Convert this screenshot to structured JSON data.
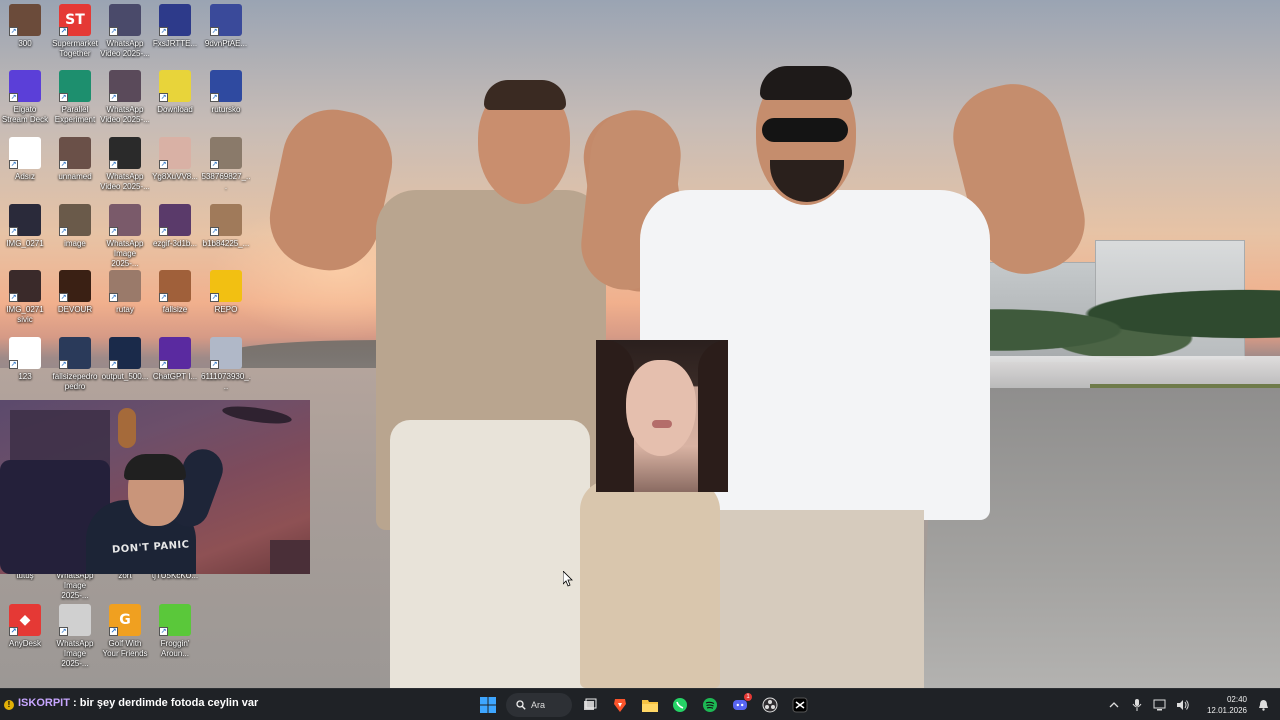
{
  "desktop": {
    "icons": [
      {
        "label": "300",
        "color": "#6b4b3a"
      },
      {
        "label": "Supermarket Together",
        "color": "#e53935",
        "glyph": "ST"
      },
      {
        "label": "WhatsApp Video 2025-...",
        "color": "#4a4a6a"
      },
      {
        "label": "FxsJRTTE...",
        "color": "#2d3a8a"
      },
      {
        "label": "9dvnPtAE...",
        "color": "#3a4a9a"
      },
      {
        "label": "Elgato Stream Deck",
        "color": "#5b3fd8"
      },
      {
        "label": "Parallel Experiment",
        "color": "#1d8f6e"
      },
      {
        "label": "WhatsApp Video 2025-...",
        "color": "#5a4a5a"
      },
      {
        "label": "Download",
        "color": "#e8d43a"
      },
      {
        "label": "rutursko",
        "color": "#2f4aa0"
      },
      {
        "label": "Adsız",
        "color": "#ffffff"
      },
      {
        "label": "unnamed",
        "color": "#6a5048"
      },
      {
        "label": "WhatsApp Video 2025-...",
        "color": "#2a2a2a"
      },
      {
        "label": "Yg8XuVV8...",
        "color": "#d9b1a5"
      },
      {
        "label": "538769827_...",
        "color": "#8a7a6a"
      },
      {
        "label": "IMG_0271",
        "color": "#2a2a3a"
      },
      {
        "label": "image",
        "color": "#6a5a4a"
      },
      {
        "label": "WhatsApp Image 2025-...",
        "color": "#7a5a6a"
      },
      {
        "label": "ezgif-3d1b...",
        "color": "#5a3a6a"
      },
      {
        "label": "b1b84225_...",
        "color": "#a07a5a"
      },
      {
        "label": "IMG_0271 sivic",
        "color": "#3a2a2a"
      },
      {
        "label": "DEVOUR",
        "color": "#3a2014"
      },
      {
        "label": "rutay",
        "color": "#9a7a6a"
      },
      {
        "label": "fallsize",
        "color": "#a0603a"
      },
      {
        "label": "REPO",
        "color": "#f2c012"
      },
      {
        "label": "123",
        "color": "#ffffff"
      },
      {
        "label": "fallsizepedro pedro",
        "color": "#2a3a5a"
      },
      {
        "label": "output_500...",
        "color": "#1a2a4a"
      },
      {
        "label": "ChatGPT I...",
        "color": "#5a2aa0"
      },
      {
        "label": "6111073930_...",
        "color": "#b0b8c8"
      },
      {
        "label": "tutuş",
        "color": "#3a3a3a"
      },
      {
        "label": "WhatsApp Image 2025-...",
        "color": "#4a4a4a"
      },
      {
        "label": "zort",
        "color": "#5a4a4a"
      },
      {
        "label": "tjTU5KcKU...",
        "color": "#4a3a3a"
      },
      {
        "label": "AnyDesk",
        "color": "#e53935",
        "glyph": "◆"
      },
      {
        "label": "WhatsApp Image 2025-...",
        "color": "#d0d0d0"
      },
      {
        "label": "Golf With Your Friends",
        "color": "#f0a020",
        "glyph": "G"
      },
      {
        "label": "Froggin' Aroun...",
        "color": "#5ac83a"
      }
    ]
  },
  "webcam": {
    "shirt_text": "DON'T PANIC"
  },
  "chat": {
    "badge": "!",
    "username": "ISKORPIT",
    "separator": ":",
    "message": "bir şey derdimde fotoda ceylin var"
  },
  "taskbar": {
    "search_label": "Ara",
    "discord_badge": "1",
    "apps": [
      "start",
      "search",
      "task-view",
      "brave",
      "file-explorer",
      "whatsapp",
      "spotify",
      "discord",
      "obs",
      "capcut"
    ]
  },
  "tray": {
    "time": "02:40",
    "date": "12.01.2026"
  },
  "colors": {
    "taskbar_bg": "#1f2226",
    "chat_username": "#c7a6ff",
    "windows_blue": "#1e90ff"
  }
}
